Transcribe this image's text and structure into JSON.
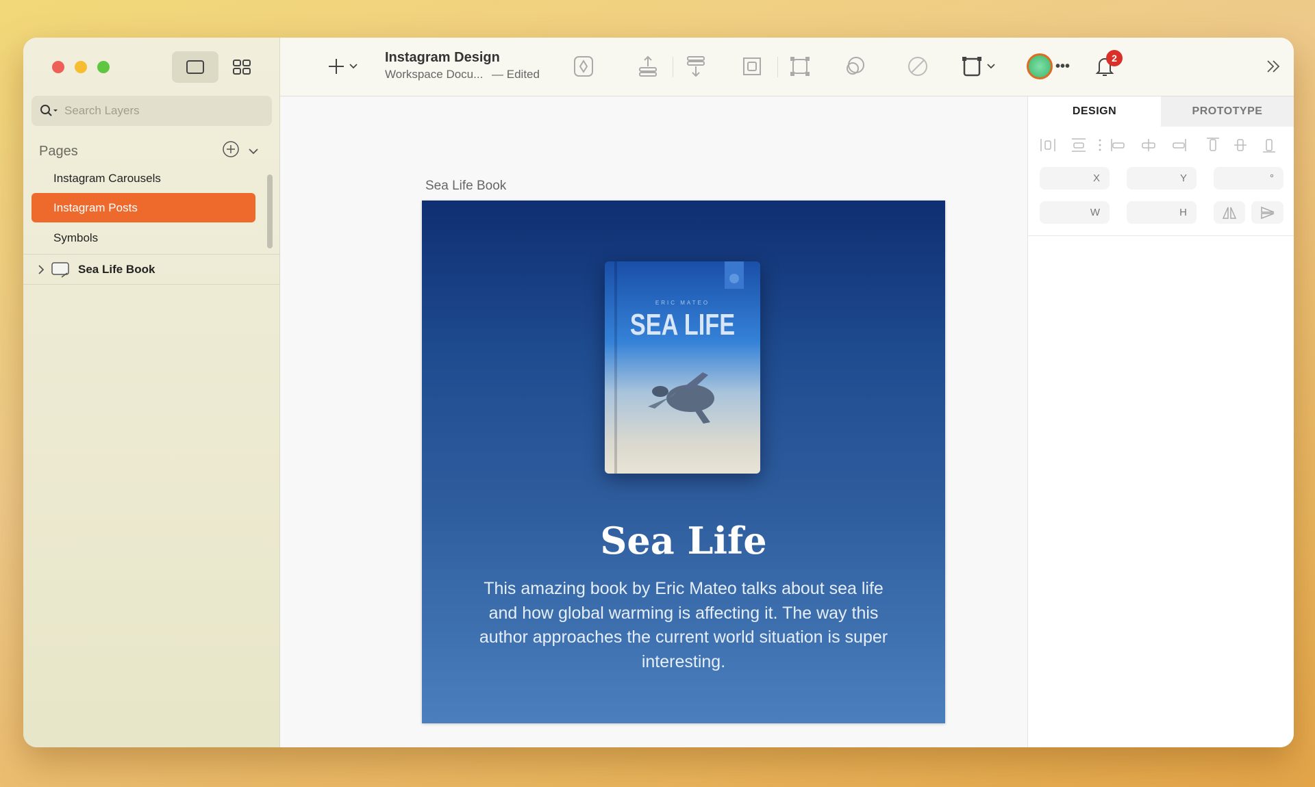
{
  "sidebar": {
    "search_placeholder": "Search Layers",
    "pages_label": "Pages",
    "pages": [
      {
        "label": "Instagram Carousels"
      },
      {
        "label": "Instagram Posts",
        "selected": true
      },
      {
        "label": "Symbols"
      }
    ],
    "layers": [
      {
        "label": "Sea Life Book"
      }
    ]
  },
  "toolbar": {
    "title": "Instagram Design",
    "subtitle": "Workspace Docu...",
    "status": "— Edited",
    "notification_count": "2"
  },
  "canvas": {
    "artboard_label": "Sea Life Book",
    "book": {
      "author": "ERIC MATEO",
      "cover_title": "SEA LIFE"
    },
    "heading": "Sea Life",
    "description": "This amazing book by Eric Mateo talks about sea life and how global warming is affecting it. The way this author approaches the current world situation is super interesting."
  },
  "inspector": {
    "tabs": [
      {
        "label": "DESIGN",
        "active": true
      },
      {
        "label": "PROTOTYPE"
      }
    ],
    "fields": {
      "x": "X",
      "y": "Y",
      "rotation": "°",
      "w": "W",
      "h": "H"
    }
  },
  "colors": {
    "accent": "#ee6a2c",
    "badge": "#d9302a"
  }
}
